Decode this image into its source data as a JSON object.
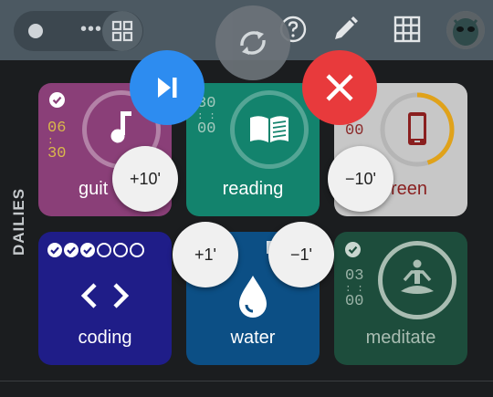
{
  "section": {
    "label": "DAILIES"
  },
  "toolbar": {
    "icons": [
      "dot-icon",
      "more-horiz-icon",
      "grid-view-icon",
      "sync-icon",
      "help-icon",
      "edit-icon",
      "apps-grid-icon",
      "avatar-icon"
    ]
  },
  "actions": {
    "skip_icon": "skip-next-icon",
    "close_icon": "close-icon",
    "plus10": "+10'",
    "minus10": "−10'",
    "plus1": "+1'",
    "minus1": "−1'"
  },
  "tiles": [
    {
      "name": "guitar",
      "name_visible": "guit",
      "time": [
        "06",
        "30"
      ],
      "icon": "music-note-icon",
      "done": true
    },
    {
      "name": "reading",
      "time": [
        "30",
        "00"
      ],
      "icon": "book-icon",
      "done": false
    },
    {
      "name": "screen",
      "name_visible": "reen",
      "time": [
        "00"
      ],
      "icon": "phone-icon",
      "done": false,
      "progress": 0.45
    },
    {
      "name": "coding",
      "icon": "code-icon",
      "checks_done": 3,
      "checks_total": 6
    },
    {
      "name": "water",
      "icon": "water-drop-icon"
    },
    {
      "name": "meditate",
      "time": [
        "03",
        "00"
      ],
      "icon": "meditate-icon",
      "done": true
    }
  ],
  "colors": {
    "topbar": "#4c5962",
    "guitar": "#8a3f78",
    "reading": "#13836d",
    "screen": "#c7c7c7",
    "coding": "#1f1d88",
    "water": "#0c4f85",
    "meditate": "#1d4d3c",
    "fab_blue": "#2d8cf0",
    "fab_red": "#e83a3c"
  }
}
